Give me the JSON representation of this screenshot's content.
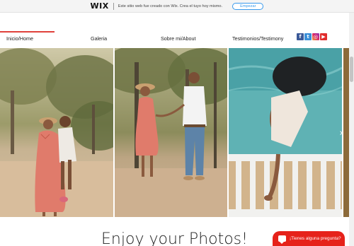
{
  "banner": {
    "logo": "WIX",
    "text": "Este sitio web fue creado con Wix. Crea el tuyo hoy mismo.",
    "button": "Empezar"
  },
  "nav": {
    "items": [
      {
        "label": "Inicio/Home",
        "active": true
      },
      {
        "label": "Galeria",
        "active": false
      },
      {
        "label": "Sobre mi/About",
        "active": false
      },
      {
        "label": "Testimonios/Testimony",
        "active": false
      }
    ],
    "social": [
      {
        "icon": "facebook-icon",
        "glyph": "f"
      },
      {
        "icon": "twitter-icon",
        "glyph": "t"
      },
      {
        "icon": "instagram-icon",
        "glyph": "◎"
      },
      {
        "icon": "youtube-icon",
        "glyph": "▶"
      }
    ]
  },
  "gallery": {
    "next_glyph": "›"
  },
  "main": {
    "heading": "Enjoy your Photos!"
  },
  "chat": {
    "label": "¡Tienes alguna pregunta?"
  },
  "colors": {
    "accent": "#e0413b",
    "chat": "#e6221a",
    "wix_button": "#3899ec"
  }
}
